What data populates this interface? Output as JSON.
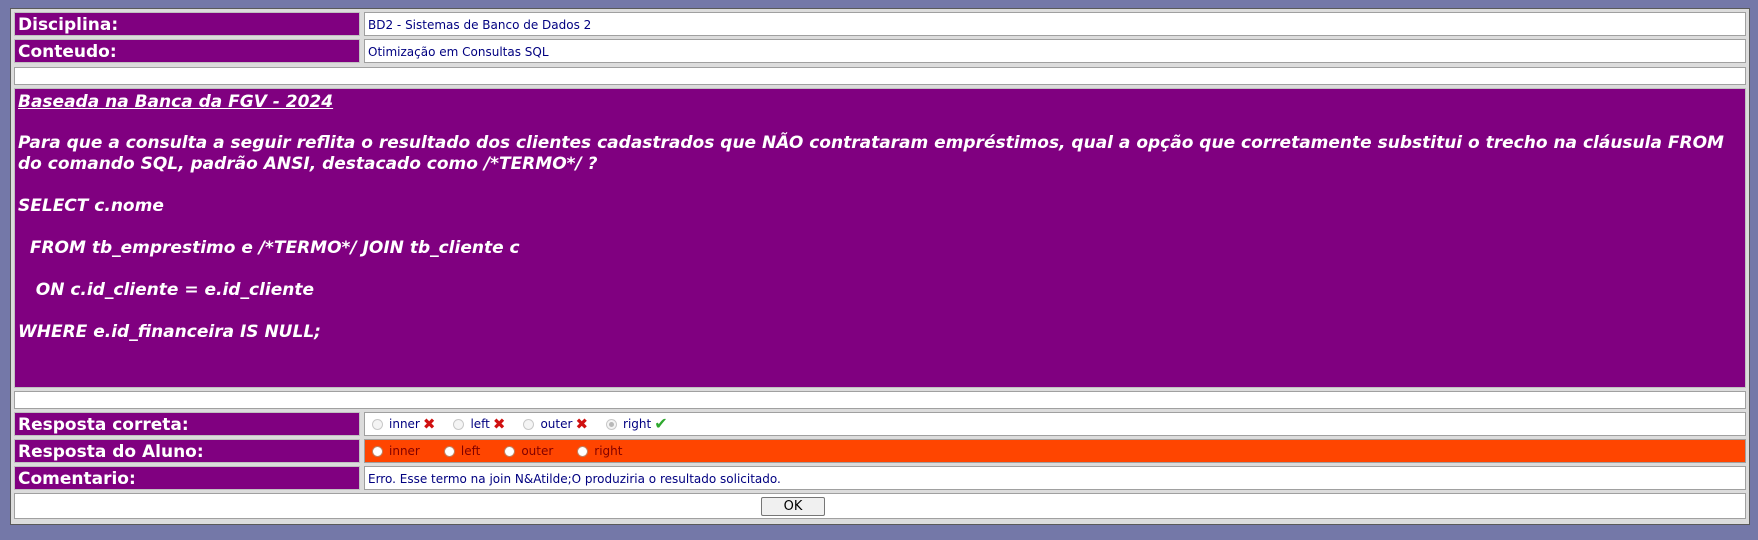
{
  "disciplina": {
    "label": "Disciplina:",
    "value": "BD2 - Sistemas de Banco de Dados 2"
  },
  "conteudo": {
    "label": "Conteudo:",
    "value": "Otimização em Consultas SQL"
  },
  "question": {
    "title": "Baseada na Banca da FGV - 2024",
    "text": "Para que a consulta a seguir reflita o resultado dos clientes cadastrados que NÃO contrataram empréstimos, qual a opção que corretamente substitui o trecho na cláusula FROM do comando SQL, padrão ANSI, destacado como /*TERMO*/ ?",
    "sql": [
      "SELECT c.nome",
      "  FROM tb_emprestimo e /*TERMO*/ JOIN tb_cliente c",
      "   ON c.id_cliente = e.id_cliente",
      "WHERE e.id_financeira IS NULL;"
    ]
  },
  "resposta_correta": {
    "label": "Resposta correta:",
    "options": [
      "inner",
      "left",
      "outer",
      "right"
    ],
    "marks": [
      "x-mark-icon",
      "x-mark-icon",
      "x-mark-icon",
      "check-icon"
    ],
    "selected": "right"
  },
  "resposta_aluno": {
    "label": "Resposta do Aluno:",
    "options": [
      "inner",
      "left",
      "outer",
      "right"
    ],
    "background": "#ff4500"
  },
  "comentario": {
    "label": "Comentario:",
    "value": "Erro. Esse termo na join N&Atilde;O produziria o resultado solicitado."
  },
  "ok_button": "OK",
  "colors": {
    "label_bg": "#800080",
    "frame": "#7478a8",
    "text_value": "#000080"
  }
}
